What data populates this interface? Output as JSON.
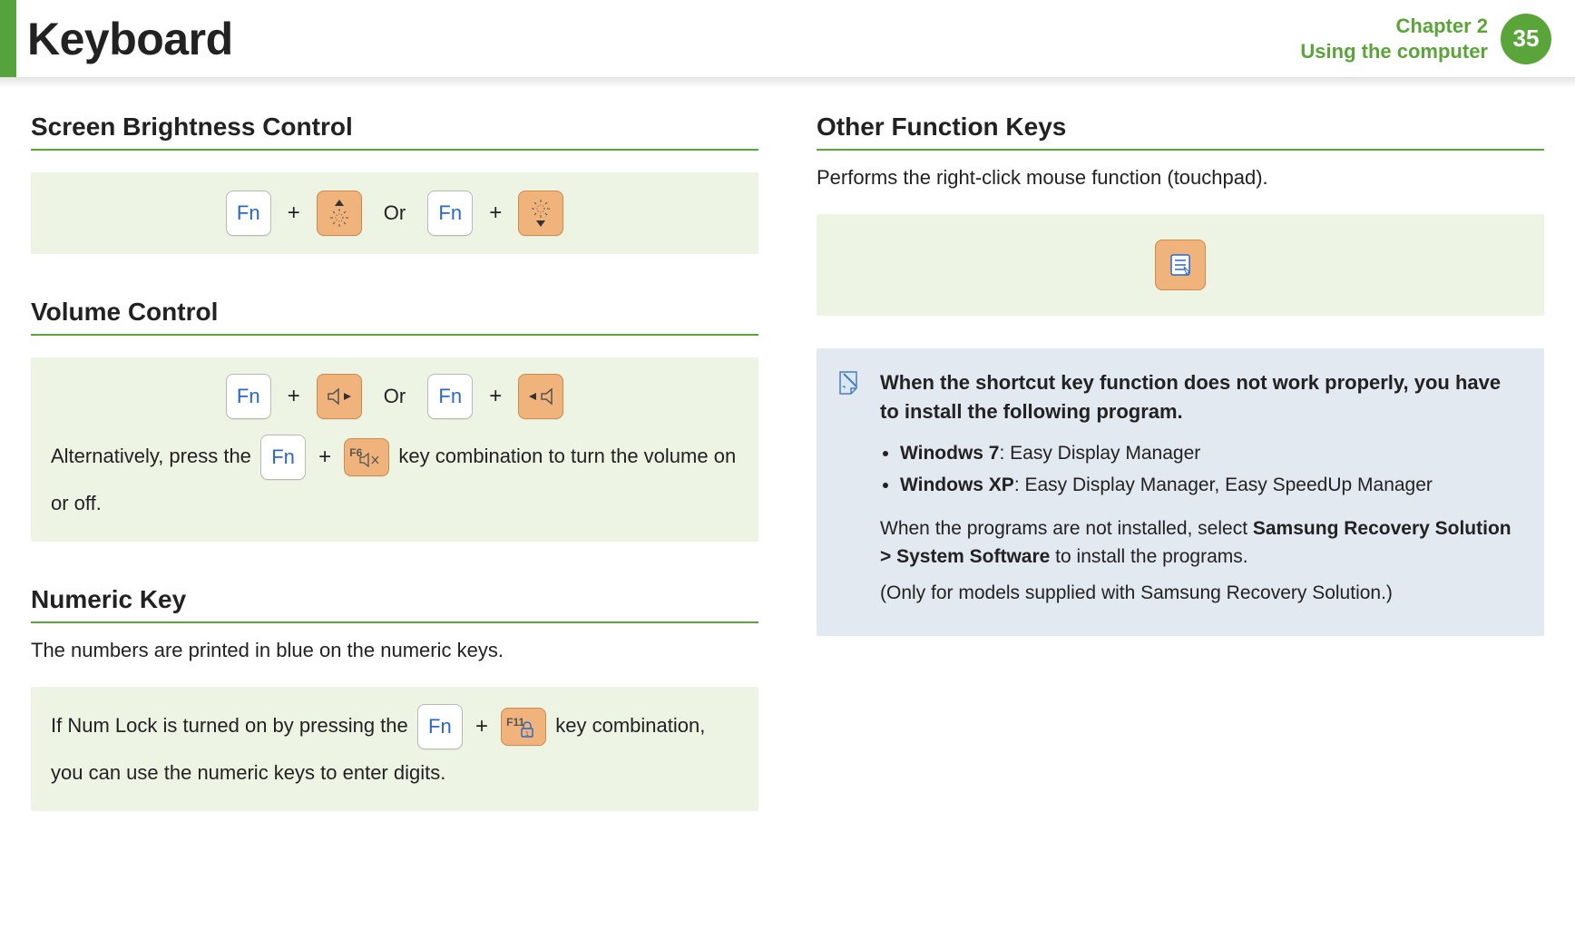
{
  "header": {
    "title": "Keyboard",
    "chapter_line1": "Chapter 2",
    "chapter_line2": "Using the computer",
    "page": "35"
  },
  "left": {
    "brightness": {
      "heading": "Screen Brightness Control",
      "fn": "Fn",
      "plus": "+",
      "or": "Or"
    },
    "volume": {
      "heading": "Volume Control",
      "fn": "Fn",
      "plus": "+",
      "or": "Or",
      "alt_before": "Alternatively, press the ",
      "f6": "F6",
      "alt_after": " key combination to turn the volume on or off."
    },
    "numeric": {
      "heading": "Numeric Key",
      "intro": "The numbers are printed in blue on the numeric keys.",
      "panel_before": "If Num Lock is turned on by pressing the ",
      "fn": "Fn",
      "plus": "+",
      "f11": "F11",
      "panel_after": " key combination, you can use the numeric keys to enter digits."
    }
  },
  "right": {
    "other": {
      "heading": "Other Function Keys",
      "intro": "Performs the right-click mouse function (touchpad)."
    },
    "note": {
      "title": "When the shortcut key function does not work properly, you have to install the following program.",
      "items": [
        {
          "os": "Winodws 7",
          "rest": ": Easy Display Manager"
        },
        {
          "os": "Windows XP",
          "rest": ": Easy Display Manager, Easy SpeedUp Manager"
        }
      ],
      "p1_a": "When the programs are not installed, select ",
      "p1_b": "Samsung Recovery Solution > System Software",
      "p1_c": " to install the programs.",
      "p2": "(Only for models supplied with Samsung Recovery Solution.)"
    }
  }
}
